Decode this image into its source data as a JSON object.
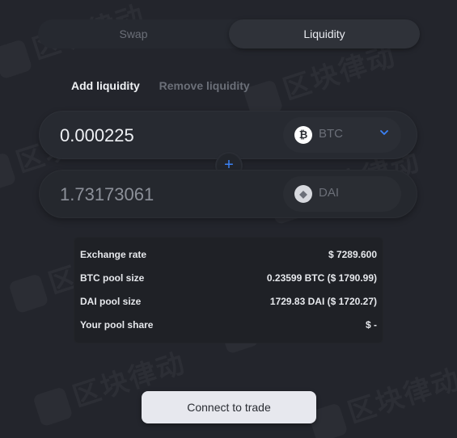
{
  "tabs": {
    "swap": "Swap",
    "liquidity": "Liquidity"
  },
  "subtabs": {
    "add": "Add liquidity",
    "remove": "Remove liquidity"
  },
  "fields": {
    "top": {
      "amount": "0.000225",
      "token": "BTC",
      "icon": "bitcoin-icon"
    },
    "bottom": {
      "amount": "1.73173061",
      "token": "DAI",
      "icon": "dai-icon"
    }
  },
  "plus_icon": "plus-icon",
  "info": [
    {
      "label": "Exchange rate",
      "value": "$ 7289.600"
    },
    {
      "label": "BTC pool size",
      "value": "0.23599 BTC ($ 1790.99)"
    },
    {
      "label": "DAI pool size",
      "value": "1729.83 DAI ($ 1720.27)"
    },
    {
      "label": "Your pool share",
      "value": "$ -"
    }
  ],
  "connect_label": "Connect to trade",
  "colors": {
    "background": "#23252c",
    "accent": "#3b82f6",
    "button": "#e7e8ee"
  }
}
